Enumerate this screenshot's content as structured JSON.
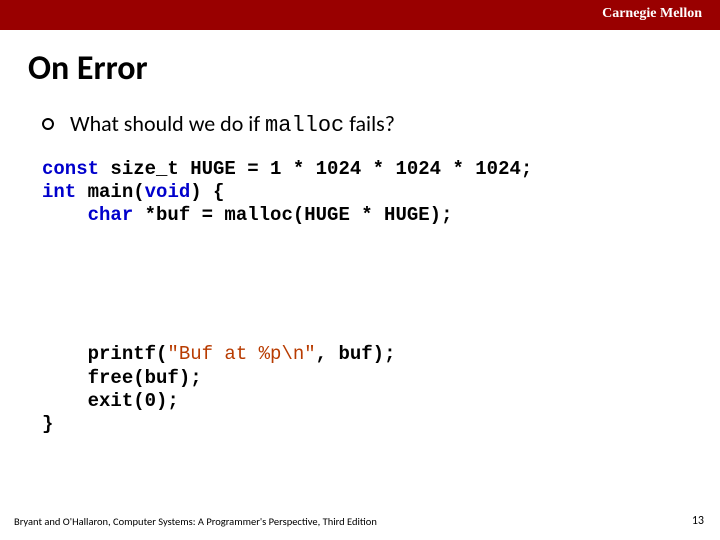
{
  "brand": "Carnegie Mellon",
  "title": "On Error",
  "bullet": {
    "pre": "What should we do if ",
    "code": "malloc",
    "post": " fails?"
  },
  "code": {
    "l1a": "const",
    "l1b": " size_t HUGE = 1 * 1024 * 1024 * 1024;",
    "l2a": "int",
    "l2b": " main(",
    "l2c": "void",
    "l2d": ") {",
    "l3a": "    ",
    "l3b": "char",
    "l3c": " *buf = malloc(HUGE * HUGE);",
    "gap": "\n\n\n\n\n",
    "l4a": "    printf(",
    "l4b": "\"Buf at %p\\n\"",
    "l4c": ", buf);",
    "l5": "    free(buf);",
    "l6": "    exit(0);",
    "l7": "}"
  },
  "footer": {
    "left": "Bryant and O'Hallaron, Computer Systems: A Programmer's Perspective, Third Edition",
    "right": "13"
  }
}
